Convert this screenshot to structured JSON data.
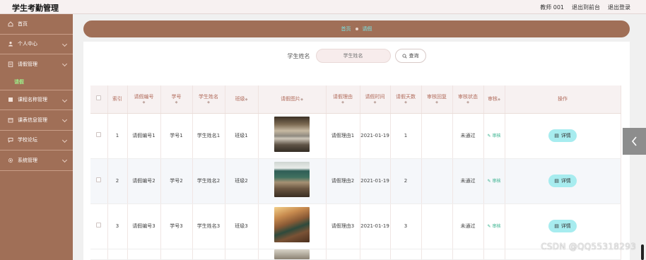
{
  "app": {
    "title": "学生考勤管理"
  },
  "topbar": {
    "user": "教师 001",
    "frontend_link": "退出到前台",
    "logout_link": "退出登录"
  },
  "sidebar": {
    "items": [
      {
        "label": "首页",
        "icon": "home-icon"
      },
      {
        "label": "个人中心",
        "icon": "user-icon"
      },
      {
        "label": "请假管理",
        "icon": "document-icon"
      },
      {
        "label": "课程名称管理",
        "icon": "book-icon"
      },
      {
        "label": "课表信息管理",
        "icon": "calendar-icon"
      },
      {
        "label": "学校论坛",
        "icon": "chat-icon"
      },
      {
        "label": "系统管理",
        "icon": "gear-icon"
      }
    ],
    "sub_item": "请假"
  },
  "breadcrumb": {
    "home": "首页",
    "current": "请假"
  },
  "search": {
    "label": "学生姓名",
    "placeholder": "学生姓名",
    "button": "查询"
  },
  "table": {
    "headers": [
      "索引",
      "请假编号",
      "学号",
      "学生姓名",
      "班级",
      "请假图片",
      "请假理由",
      "请假时间",
      "请假天数",
      "审核回复",
      "审核状态",
      "审核",
      "操作"
    ],
    "rows": [
      {
        "index": "1",
        "leave_no": "请假编号1",
        "student_no": "学号1",
        "name": "学生姓名1",
        "class": "班级1",
        "reason": "请假理由1",
        "time": "2021-01-19",
        "days": "1",
        "reply": "",
        "status": "未通过",
        "audit": "审核",
        "action": "详情"
      },
      {
        "index": "2",
        "leave_no": "请假编号2",
        "student_no": "学号2",
        "name": "学生姓名2",
        "class": "班级2",
        "reason": "请假理由2",
        "time": "2021-01-19",
        "days": "2",
        "reply": "",
        "status": "未通过",
        "audit": "审核",
        "action": "详情"
      },
      {
        "index": "3",
        "leave_no": "请假编号3",
        "student_no": "学号3",
        "name": "学生姓名3",
        "class": "班级3",
        "reason": "请假理由3",
        "time": "2021-01-19",
        "days": "3",
        "reply": "",
        "status": "未通过",
        "audit": "审核",
        "action": "详情"
      }
    ]
  },
  "watermark": "CSDN @QQ55318293",
  "colors": {
    "sidebar": "#a06f57",
    "breadcrumb_text": "#79e3e3",
    "sub_item": "#9ef08a",
    "detail_button": "#a7ecef"
  }
}
